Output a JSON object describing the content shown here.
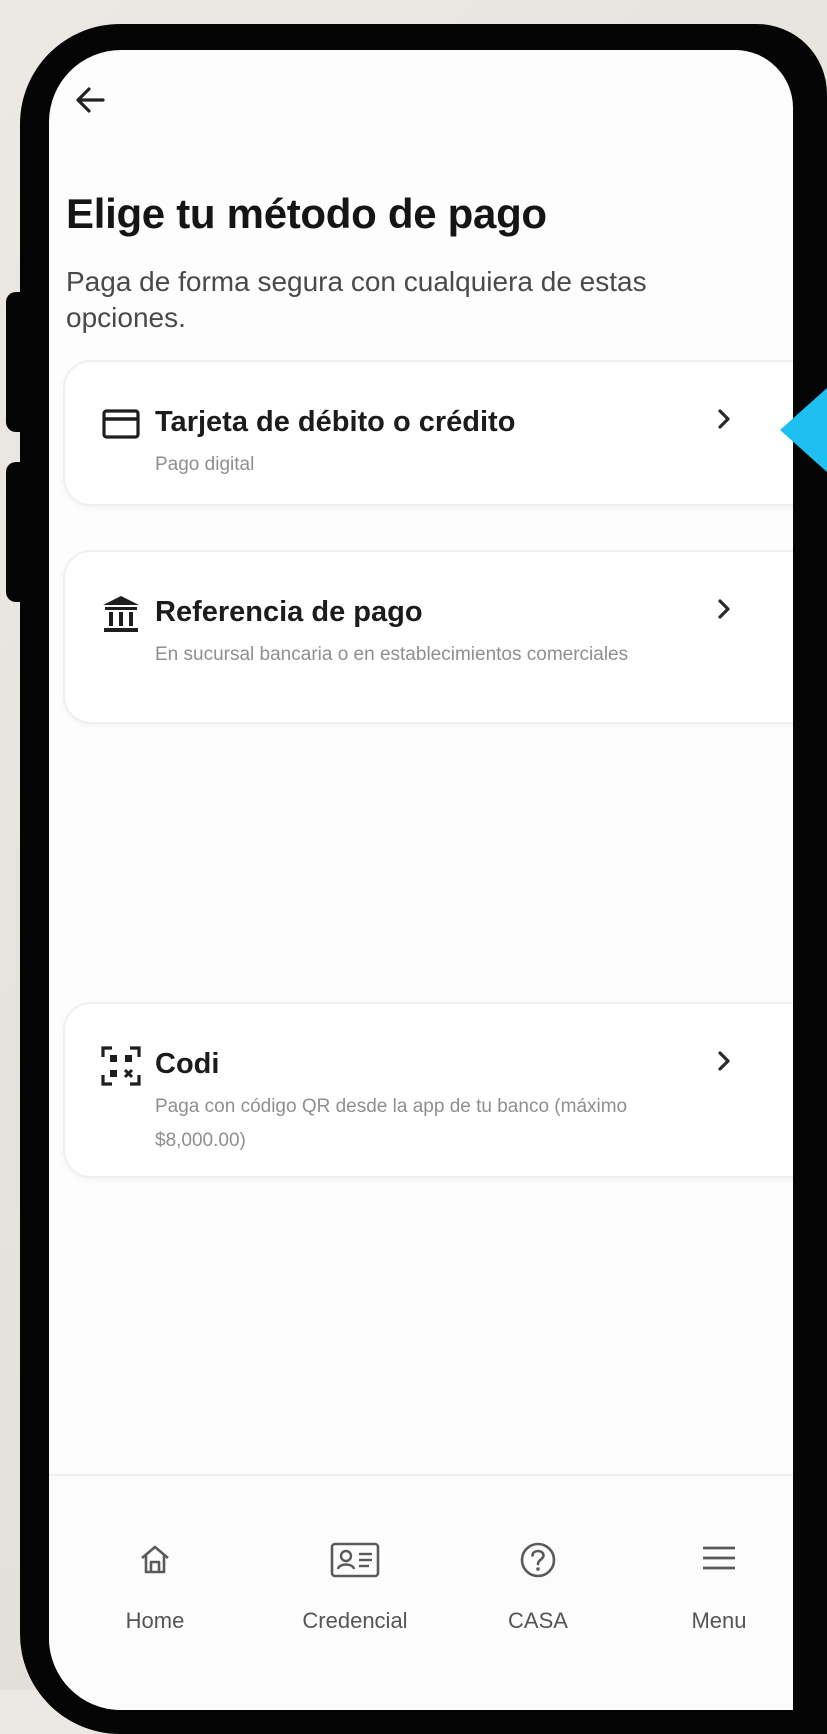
{
  "header": {
    "title": "Elige tu método de pago",
    "subtitle": "Paga de forma segura con cualquiera de estas opciones."
  },
  "payment_options": [
    {
      "icon": "credit-card-icon",
      "title": "Tarjeta de débito o crédito",
      "description": "Pago digital"
    },
    {
      "icon": "bank-icon",
      "title": "Referencia de pago",
      "description": "En sucursal bancaria o en establecimientos comerciales"
    },
    {
      "icon": "qr-scan-icon",
      "title": "Codi",
      "description": "Paga con código QR desde la app de tu banco (máximo $8,000.00)"
    }
  ],
  "bottom_nav": [
    {
      "icon": "home-icon",
      "label": "Home"
    },
    {
      "icon": "id-card-icon",
      "label": "Credencial"
    },
    {
      "icon": "help-circle-icon",
      "label": "CASA"
    },
    {
      "icon": "menu-icon",
      "label": "Menu"
    }
  ],
  "colors": {
    "pointer_accent": "#1ec0f2",
    "title_text": "#151515",
    "secondary_text": "#8f8f8f",
    "card_border": "#efefef"
  }
}
